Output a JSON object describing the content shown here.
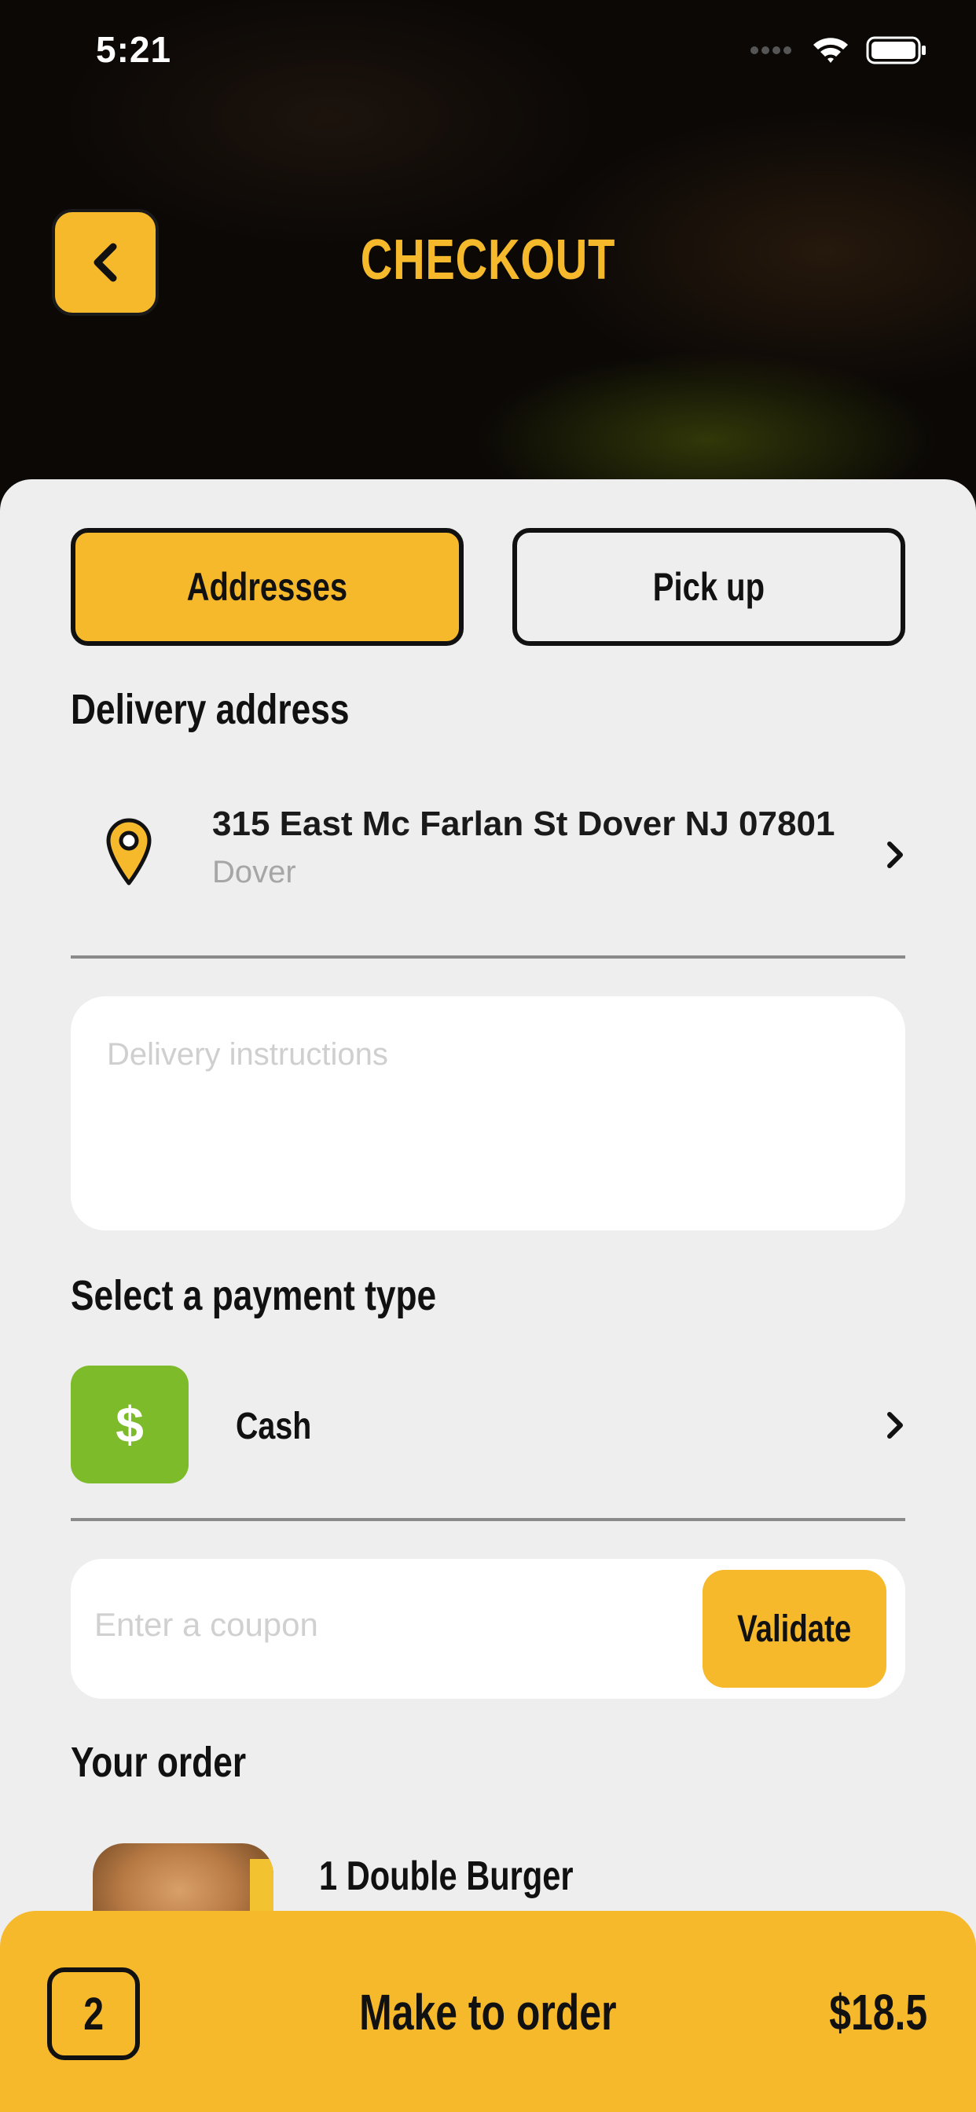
{
  "status_bar": {
    "time": "5:21"
  },
  "header": {
    "title": "CHECKOUT"
  },
  "tabs": [
    {
      "label": "Addresses",
      "active": true
    },
    {
      "label": "Pick up",
      "active": false
    }
  ],
  "delivery": {
    "section_title": "Delivery address",
    "address_line": "315 East Mc Farlan St Dover NJ 07801",
    "city": "Dover",
    "instructions_placeholder": "Delivery instructions"
  },
  "payment": {
    "section_title": "Select a payment type",
    "method_symbol": "$",
    "method_label": "Cash",
    "method_color": "#7DBB2A"
  },
  "coupon": {
    "placeholder": "Enter a coupon",
    "button_label": "Validate"
  },
  "order": {
    "section_title": "Your order",
    "items": [
      {
        "name": "1 Double Burger"
      }
    ]
  },
  "footer": {
    "count": "2",
    "label": "Make to order",
    "price": "$18.5"
  },
  "colors": {
    "accent": "#F6B92B",
    "background": "#EEEEEE",
    "text": "#111111"
  }
}
